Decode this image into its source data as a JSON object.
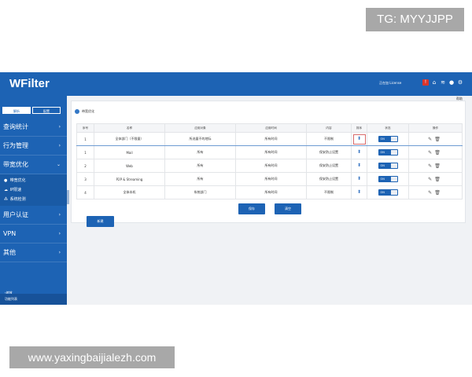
{
  "watermarks": {
    "top_right": "TG: MYYJJPP",
    "bottom_left": "www.yaxingbaijialezh.com"
  },
  "app": {
    "brand": "WFilter",
    "license": "正在加 License",
    "top_icons": [
      "alert-icon",
      "home-icon",
      "wifi-icon",
      "user-icon",
      "settings-icon"
    ],
    "alert_badge": "!"
  },
  "sidebar": {
    "tabs": [
      {
        "label": "解析"
      },
      {
        "label": "配置"
      }
    ],
    "menu": [
      {
        "label": "查询统计",
        "chevron": "›"
      },
      {
        "label": "行为管理",
        "chevron": "›"
      },
      {
        "label": "带宽优化",
        "chevron": "⌄"
      }
    ],
    "submenu": [
      {
        "label": "带宽优化",
        "icon": "●"
      },
      {
        "label": "IP限速",
        "icon": "☁"
      },
      {
        "label": "系统检测",
        "icon": "⁂"
      }
    ],
    "menu2": [
      {
        "label": "用户认证",
        "chevron": "›"
      },
      {
        "label": "VPN",
        "chevron": "›"
      },
      {
        "label": "其他",
        "chevron": "›"
      }
    ],
    "collapse": "‹缩放",
    "footer": "功能列表"
  },
  "content": {
    "help": "帮助",
    "breadcrumb": "带宽优化",
    "columns": [
      "序号",
      "名称",
      "应用对象",
      "应用时间",
      "内容",
      "排序",
      "状态",
      "操作"
    ],
    "rows": [
      {
        "no": "1",
        "name": "全体部门（不限量）",
        "target": "所选量不的地际",
        "time": "所有时间",
        "content": "不限制",
        "status": "ON"
      },
      {
        "no": "1",
        "name": "Mail",
        "target": "所有",
        "time": "所有时间",
        "content": "保安防止设置",
        "status": "ON"
      },
      {
        "no": "2",
        "name": "Web",
        "target": "所有",
        "time": "所有时间",
        "content": "保安防止设置",
        "status": "ON"
      },
      {
        "no": "3",
        "name": "P2P & Streaming",
        "target": "所有",
        "time": "所有时间",
        "content": "保安防止设置",
        "status": "ON"
      },
      {
        "no": "4",
        "name": "全体本机",
        "target": "系统部门",
        "time": "所有时间",
        "content": "不限制",
        "status": "ON"
      }
    ],
    "buttons": {
      "save": "保存",
      "clear": "清空",
      "add": "新建"
    },
    "colors": {
      "primary": "#1d63b4",
      "sidebar": "#1d63b4"
    }
  }
}
